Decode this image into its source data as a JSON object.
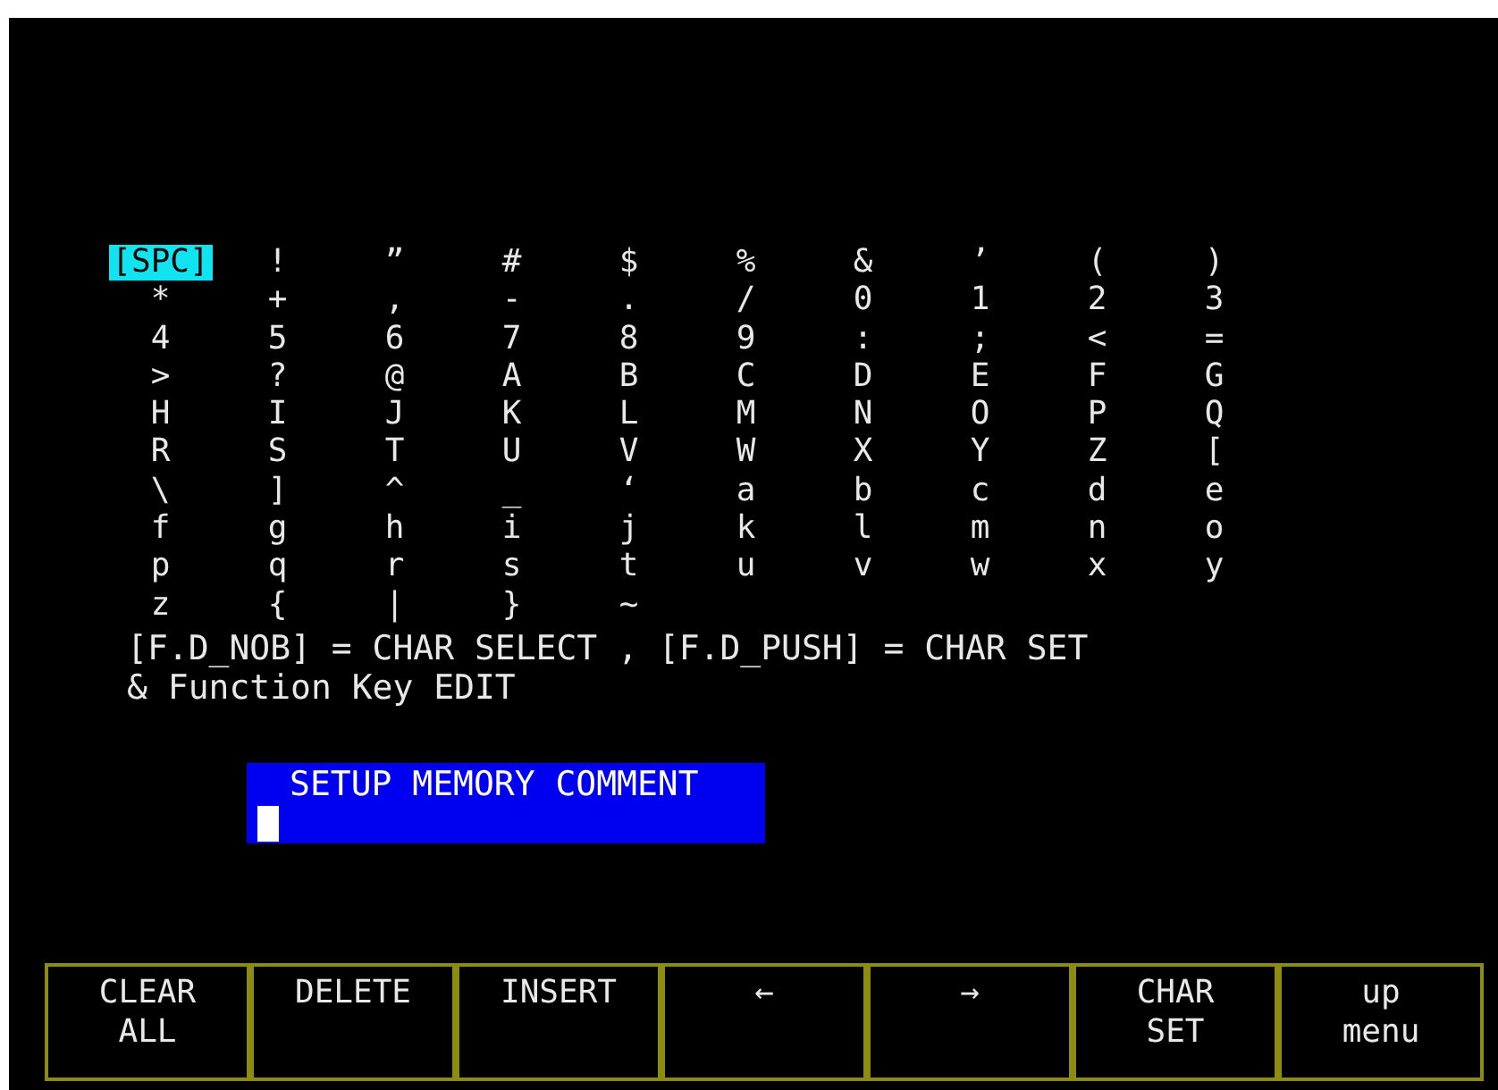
{
  "char_table": [
    {
      "char": "[SPC]",
      "selected": true
    },
    {
      "char": "!",
      "selected": false
    },
    {
      "char": "”",
      "selected": false
    },
    {
      "char": "#",
      "selected": false
    },
    {
      "char": "$",
      "selected": false
    },
    {
      "char": "%",
      "selected": false
    },
    {
      "char": "&",
      "selected": false
    },
    {
      "char": "’",
      "selected": false
    },
    {
      "char": "(",
      "selected": false
    },
    {
      "char": ")",
      "selected": false
    },
    {
      "char": "*",
      "selected": false
    },
    {
      "char": "+",
      "selected": false
    },
    {
      "char": ",",
      "selected": false
    },
    {
      "char": "-",
      "selected": false
    },
    {
      "char": ".",
      "selected": false
    },
    {
      "char": "/",
      "selected": false
    },
    {
      "char": "0",
      "selected": false
    },
    {
      "char": "1",
      "selected": false
    },
    {
      "char": "2",
      "selected": false
    },
    {
      "char": "3",
      "selected": false
    },
    {
      "char": "4",
      "selected": false
    },
    {
      "char": "5",
      "selected": false
    },
    {
      "char": "6",
      "selected": false
    },
    {
      "char": "7",
      "selected": false
    },
    {
      "char": "8",
      "selected": false
    },
    {
      "char": "9",
      "selected": false
    },
    {
      "char": ":",
      "selected": false
    },
    {
      "char": ";",
      "selected": false
    },
    {
      "char": "<",
      "selected": false
    },
    {
      "char": "=",
      "selected": false
    },
    {
      "char": ">",
      "selected": false
    },
    {
      "char": "?",
      "selected": false
    },
    {
      "char": "@",
      "selected": false
    },
    {
      "char": "A",
      "selected": false
    },
    {
      "char": "B",
      "selected": false
    },
    {
      "char": "C",
      "selected": false
    },
    {
      "char": "D",
      "selected": false
    },
    {
      "char": "E",
      "selected": false
    },
    {
      "char": "F",
      "selected": false
    },
    {
      "char": "G",
      "selected": false
    },
    {
      "char": "H",
      "selected": false
    },
    {
      "char": "I",
      "selected": false
    },
    {
      "char": "J",
      "selected": false
    },
    {
      "char": "K",
      "selected": false
    },
    {
      "char": "L",
      "selected": false
    },
    {
      "char": "M",
      "selected": false
    },
    {
      "char": "N",
      "selected": false
    },
    {
      "char": "O",
      "selected": false
    },
    {
      "char": "P",
      "selected": false
    },
    {
      "char": "Q",
      "selected": false
    },
    {
      "char": "R",
      "selected": false
    },
    {
      "char": "S",
      "selected": false
    },
    {
      "char": "T",
      "selected": false
    },
    {
      "char": "U",
      "selected": false
    },
    {
      "char": "V",
      "selected": false
    },
    {
      "char": "W",
      "selected": false
    },
    {
      "char": "X",
      "selected": false
    },
    {
      "char": "Y",
      "selected": false
    },
    {
      "char": "Z",
      "selected": false
    },
    {
      "char": "[",
      "selected": false
    },
    {
      "char": "\\",
      "selected": false
    },
    {
      "char": "]",
      "selected": false
    },
    {
      "char": "^",
      "selected": false
    },
    {
      "char": "_",
      "selected": false
    },
    {
      "char": "‘",
      "selected": false
    },
    {
      "char": "a",
      "selected": false
    },
    {
      "char": "b",
      "selected": false
    },
    {
      "char": "c",
      "selected": false
    },
    {
      "char": "d",
      "selected": false
    },
    {
      "char": "e",
      "selected": false
    },
    {
      "char": "f",
      "selected": false
    },
    {
      "char": "g",
      "selected": false
    },
    {
      "char": "h",
      "selected": false
    },
    {
      "char": "i",
      "selected": false
    },
    {
      "char": "j",
      "selected": false
    },
    {
      "char": "k",
      "selected": false
    },
    {
      "char": "l",
      "selected": false
    },
    {
      "char": "m",
      "selected": false
    },
    {
      "char": "n",
      "selected": false
    },
    {
      "char": "o",
      "selected": false
    },
    {
      "char": "p",
      "selected": false
    },
    {
      "char": "q",
      "selected": false
    },
    {
      "char": "r",
      "selected": false
    },
    {
      "char": "s",
      "selected": false
    },
    {
      "char": "t",
      "selected": false
    },
    {
      "char": "u",
      "selected": false
    },
    {
      "char": "v",
      "selected": false
    },
    {
      "char": "w",
      "selected": false
    },
    {
      "char": "x",
      "selected": false
    },
    {
      "char": "y",
      "selected": false
    },
    {
      "char": "z",
      "selected": false
    },
    {
      "char": "{",
      "selected": false
    },
    {
      "char": "|",
      "selected": false
    },
    {
      "char": "}",
      "selected": false
    },
    {
      "char": "~",
      "selected": false
    }
  ],
  "instructions": [
    "[F.D_NOB] = CHAR SELECT , [F.D_PUSH] = CHAR SET",
    "& Function Key EDIT"
  ],
  "comment_field": {
    "title": "SETUP MEMORY COMMENT"
  },
  "softkeys": [
    {
      "label": "CLEAR\nALL"
    },
    {
      "label": "DELETE"
    },
    {
      "label": "INSERT"
    },
    {
      "label": "←"
    },
    {
      "label": "→"
    },
    {
      "label": "CHAR\nSET"
    },
    {
      "label": "up\nmenu"
    }
  ]
}
